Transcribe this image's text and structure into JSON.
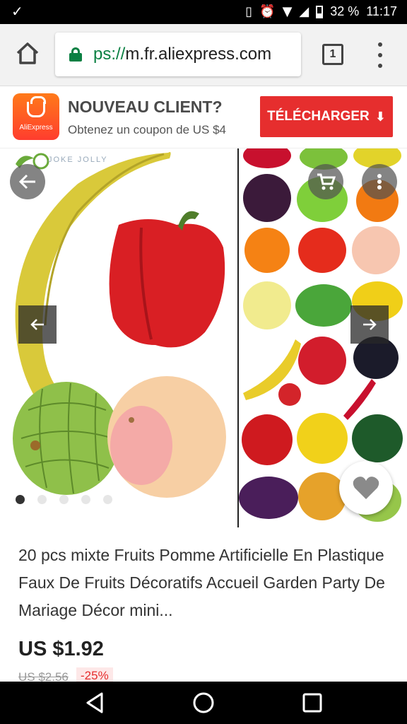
{
  "status_bar": {
    "battery": "32 %",
    "time": "11:17"
  },
  "browser": {
    "url_scheme": "ps://",
    "url_host": "m.fr.aliexpress.com",
    "tab_count": "1"
  },
  "promo": {
    "logo_text": "AliExpress",
    "title": "NOUVEAU CLIENT?",
    "subtitle": "Obtenez un coupon de US $4",
    "download_label": "TÉLÉCHARGER"
  },
  "gallery": {
    "watermark": "JOKE JOLLY",
    "slide_count": 5,
    "active_slide": 1
  },
  "product": {
    "title": "20 pcs mixte Fruits Pomme Artificielle En Plastique Faux De Fruits Décoratifs Accueil Garden Party De Mariage Décor mini...",
    "price": "US $1.92",
    "original_price": "US $2.56",
    "discount": "-25%"
  },
  "colors": {
    "accent": "#e62e2e",
    "secure": "#0b8043"
  }
}
